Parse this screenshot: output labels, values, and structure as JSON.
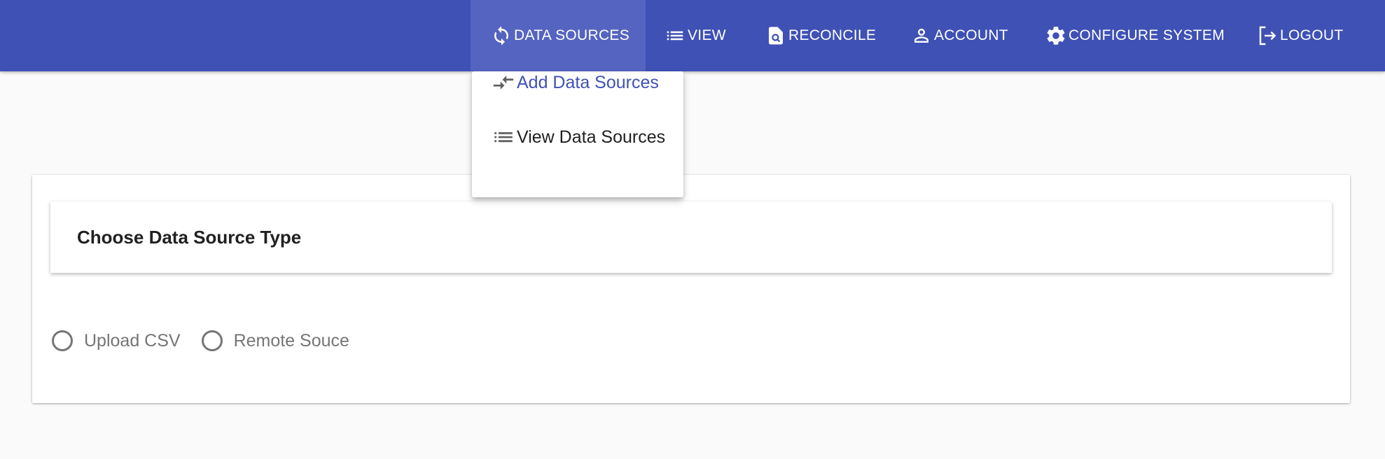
{
  "nav": {
    "items": [
      {
        "label": "DATA SOURCES",
        "icon": "sync-icon",
        "active": true
      },
      {
        "label": "VIEW",
        "icon": "list-icon"
      },
      {
        "label": "RECONCILE",
        "icon": "document-search-icon"
      },
      {
        "label": "ACCOUNT",
        "icon": "person-icon"
      },
      {
        "label": "CONFIGURE SYSTEM",
        "icon": "gear-icon"
      },
      {
        "label": "LOGOUT",
        "icon": "logout-icon"
      }
    ]
  },
  "menu": {
    "items": [
      {
        "label": "Add Data Sources",
        "icon": "compare-arrows-icon",
        "selected": true
      },
      {
        "label": "View Data Sources",
        "icon": "list-icon"
      }
    ]
  },
  "card": {
    "title": "Choose Data Source Type",
    "options": [
      {
        "label": "Upload CSV",
        "checked": false
      },
      {
        "label": "Remote Souce",
        "checked": false
      }
    ]
  },
  "colors": {
    "primary": "#3f51b5",
    "active_nav": "#5564c0",
    "background": "#fafafa",
    "muted_text": "#757575"
  }
}
